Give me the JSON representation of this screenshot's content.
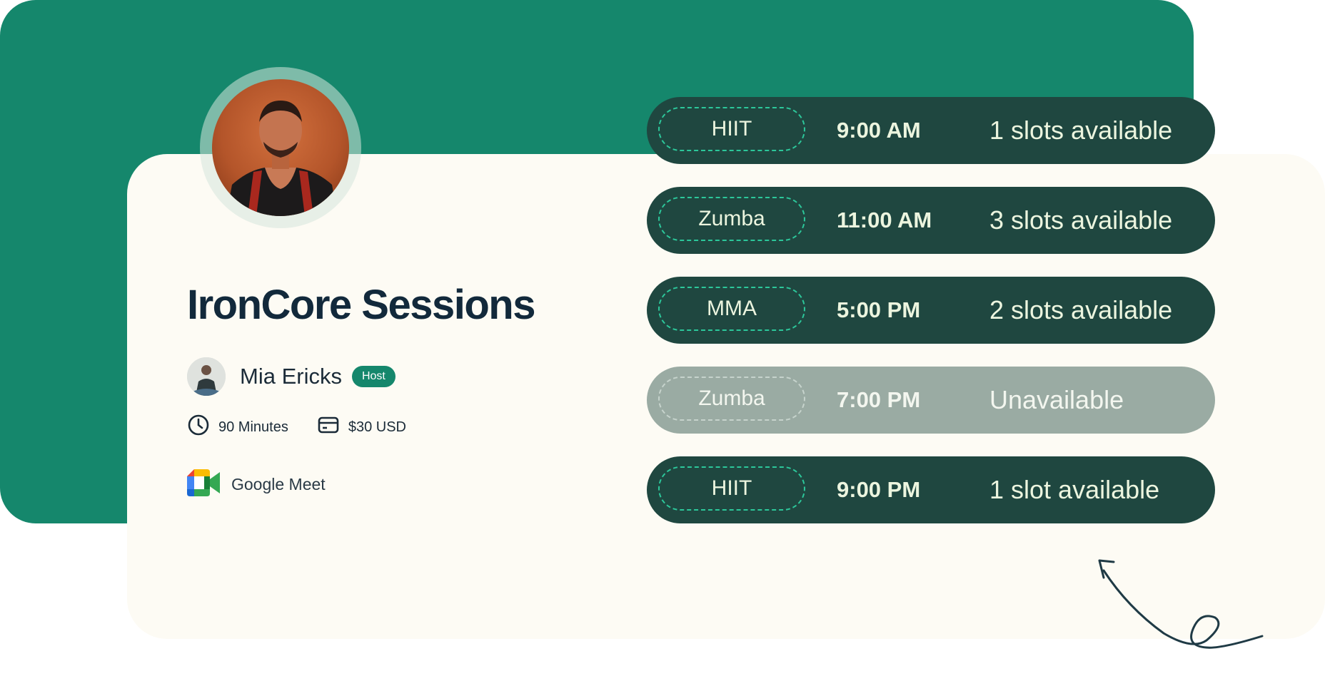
{
  "event": {
    "title": "IronCore Sessions",
    "host_name": "Mia Ericks",
    "host_badge": "Host",
    "duration": "90 Minutes",
    "price": "$30 USD",
    "platform": "Google Meet"
  },
  "slots": [
    {
      "class": "HIIT",
      "time": "9:00 AM",
      "availability": "1 slots available",
      "available": true
    },
    {
      "class": "Zumba",
      "time": "11:00 AM",
      "availability": "3 slots available",
      "available": true
    },
    {
      "class": "MMA",
      "time": "5:00 PM",
      "availability": "2 slots available",
      "available": true
    },
    {
      "class": "Zumba",
      "time": "7:00 PM",
      "availability": "Unavailable",
      "available": false
    },
    {
      "class": "HIIT",
      "time": "9:00 PM",
      "availability": "1 slot available",
      "available": true
    }
  ],
  "icons": {
    "duration": "clock-icon",
    "price": "card-icon",
    "platform": "google-meet-icon",
    "decoration": "curly-arrow-icon"
  },
  "colors": {
    "brand_green": "#15876c",
    "slot_dark": "#1f4740",
    "slot_unavailable": "#9aaba3",
    "card_bg": "#fdfbf4",
    "title_text": "#12293b"
  }
}
